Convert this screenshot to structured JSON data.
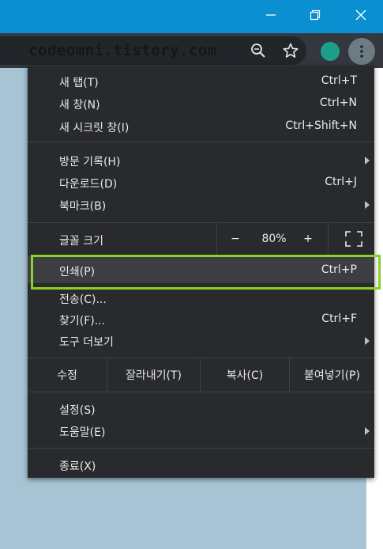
{
  "watermark": "codeomni.tistory.com",
  "icons": {
    "zoom": "zoom-icon",
    "star": "star-icon",
    "profile": "profile-avatar",
    "menu": "three-dot-menu-icon",
    "minimize": "minimize-icon",
    "restore": "restore-icon",
    "close": "close-icon",
    "fullscreen": "fullscreen-icon",
    "submenu_arrow": "submenu-arrow-icon"
  },
  "colors": {
    "titlebar": "#0a8fd1",
    "menu_bg": "#292a2d",
    "highlight_border": "#8bd11f",
    "profile": "#1e9d8b"
  },
  "menu": {
    "new_tab": {
      "label": "새 탭(T)",
      "shortcut": "Ctrl+T"
    },
    "new_window": {
      "label": "새 창(N)",
      "shortcut": "Ctrl+N"
    },
    "incognito": {
      "label": "새 시크릿 창(I)",
      "shortcut": "Ctrl+Shift+N"
    },
    "history": {
      "label": "방문 기록(H)"
    },
    "downloads": {
      "label": "다운로드(D)",
      "shortcut": "Ctrl+J"
    },
    "bookmarks": {
      "label": "북마크(B)"
    },
    "zoom": {
      "label": "글꼴 크기",
      "minus": "−",
      "value": "80%",
      "plus": "+"
    },
    "print": {
      "label": "인쇄(P)",
      "shortcut": "Ctrl+P"
    },
    "cast": {
      "label": "전송(C)..."
    },
    "find": {
      "label": "찾기(F)...",
      "shortcut": "Ctrl+F"
    },
    "more_tools": {
      "label": "도구 더보기"
    },
    "edit": {
      "label": "수정",
      "cut": "잘라내기(T)",
      "copy": "복사(C)",
      "paste": "붙여넣기(P)"
    },
    "settings": {
      "label": "설정(S)"
    },
    "help": {
      "label": "도움말(E)"
    },
    "exit": {
      "label": "종료(X)"
    }
  }
}
